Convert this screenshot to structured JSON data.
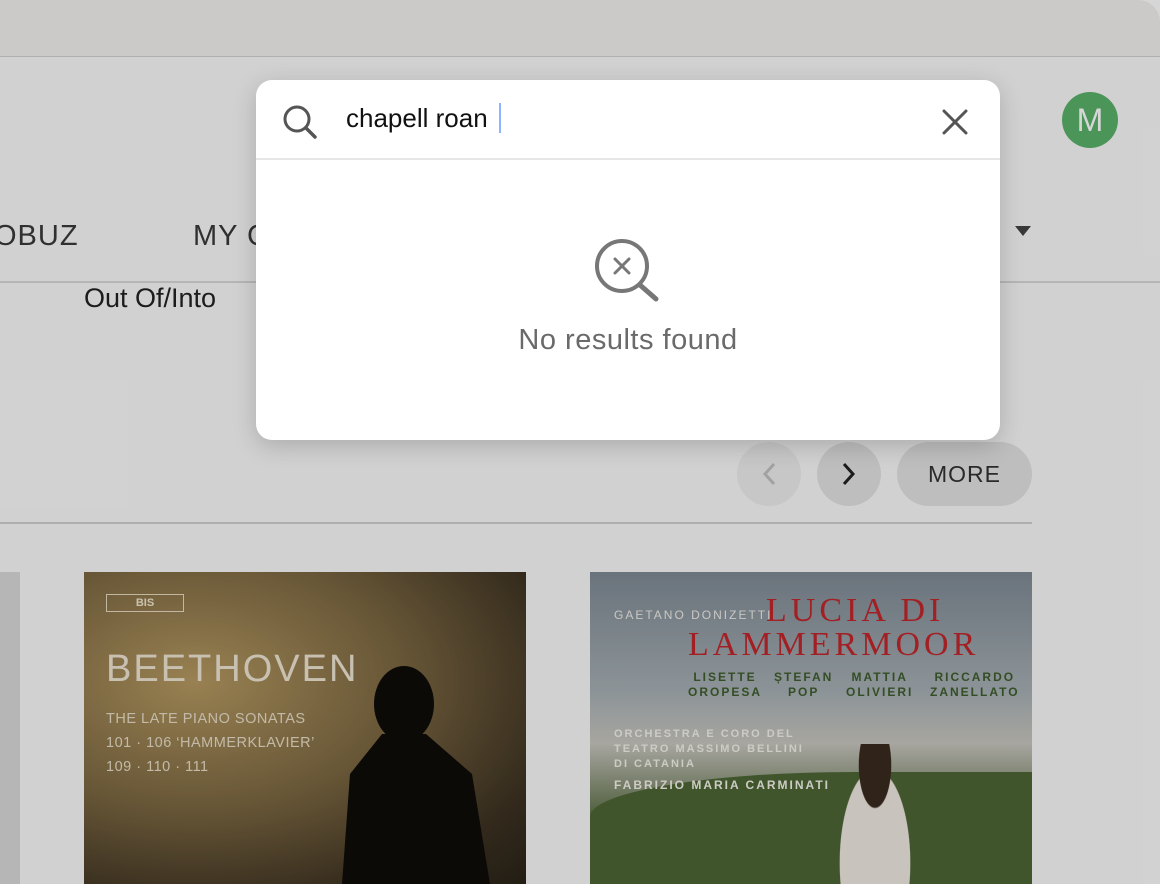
{
  "user": {
    "avatar_letter": "M",
    "avatar_color": "#5ab26a"
  },
  "nav": {
    "items": [
      {
        "label": "OBUZ"
      },
      {
        "label": "MY C"
      }
    ]
  },
  "carousel": {
    "album_title": "Out Of/Into",
    "more_label": "MORE"
  },
  "covers": {
    "beethoven": {
      "label": "BIS",
      "composer": "BEETHOVEN",
      "line1": "THE LATE PIANO SONATAS",
      "line2": "101 · 106 ‘HAMMERKLAVIER’",
      "line3": "109 · 110 · 111"
    },
    "lucia": {
      "composer": "GAETANO DONIZETTI",
      "title_line1": "LUCIA DI",
      "title_line2": "LAMMERMOOR",
      "cast": [
        {
          "first": "LISETTE",
          "last": "OROPESA"
        },
        {
          "first": "ȘTEFAN",
          "last": "POP"
        },
        {
          "first": "MATTIA",
          "last": "OLIVIERI"
        },
        {
          "first": "RICCARDO",
          "last": "ZANELLATO"
        }
      ],
      "orchestra_line1": "ORCHESTRA E CORO DEL",
      "orchestra_line2": "TEATRO MASSIMO BELLINI",
      "orchestra_line3": "DI CATANIA",
      "conductor": "FABRIZIO MARIA CARMINATI"
    }
  },
  "search_modal": {
    "query": "chapell roan",
    "empty_message": "No results found"
  },
  "icons": {
    "search": "search-icon",
    "close": "close-icon",
    "no_results": "search-x-icon",
    "caret_down": "caret-down-icon",
    "chevron_left": "chevron-left-icon",
    "chevron_right": "chevron-right-icon"
  }
}
